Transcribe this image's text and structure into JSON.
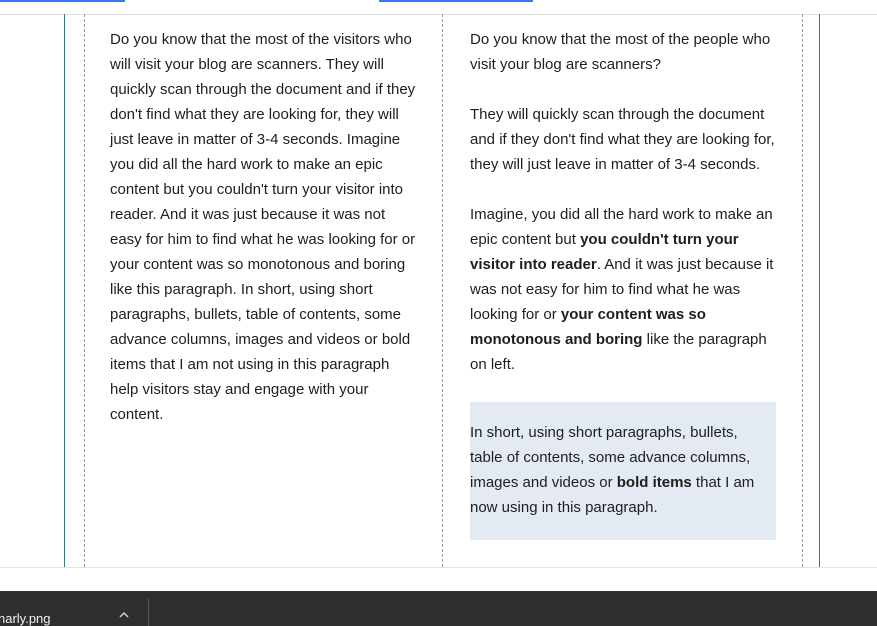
{
  "left_column": {
    "text": "Do you know that the most of the visitors who will visit your blog are scanners. They will quickly scan through the document and if they don't find what they are looking for, they will just leave in matter of 3-4 seconds. Imagine you did all the hard work to make an epic content but you couldn't turn your visitor into reader. And it was just because it was not easy for him to find what he was looking for or your content was so monotonous and boring like this paragraph. In short, using short paragraphs, bullets, table of contents, some advance columns, images and videos  or bold items that I am not using in this paragraph help visitors stay and engage with your content."
  },
  "right_column": {
    "p1": "Do you know that the most of the people who visit your blog are scanners?",
    "p2": "They will quickly scan through the document and if they don't find what they are looking for, they will just leave in matter of 3-4 seconds.",
    "p3_a": "Imagine, you did all the hard work to make an epic content but ",
    "p3_bold1": "you couldn't turn your visitor into reader",
    "p3_b": ". And it was just because it was not easy for him to find what he was looking for or ",
    "p3_bold2": "your content was so monotonous and boring",
    "p3_c": " like the paragraph on left.",
    "highlight_a": "In short, using short paragraphs, bullets, table of contents, some advance columns, images and videos or ",
    "highlight_bold": "bold items",
    "highlight_b": " that I am now using in this paragraph."
  },
  "download_bar": {
    "filename": "narly.png",
    "chevron_icon": "chevron-up-icon"
  }
}
